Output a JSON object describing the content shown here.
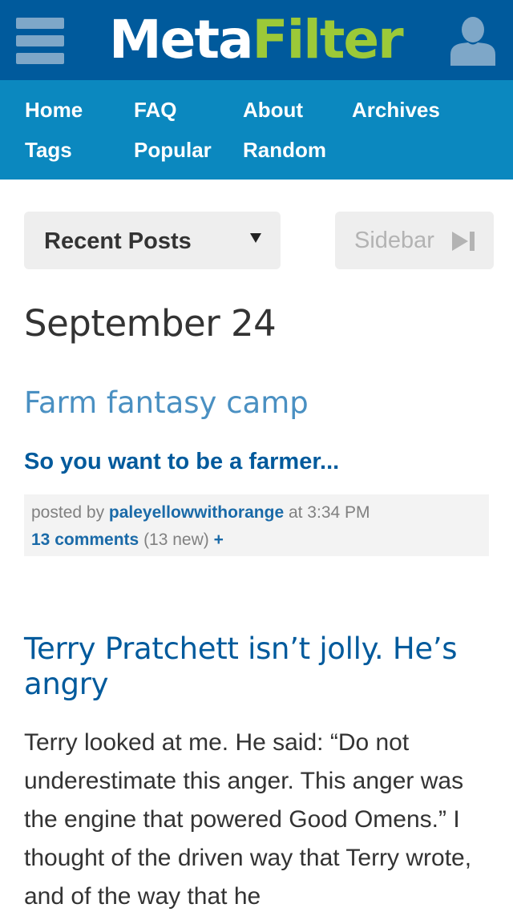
{
  "header": {
    "logo_part1": "Meta",
    "logo_part2": "Filter",
    "menu_icon": "hamburger-menu-icon",
    "user_icon": "user-silhouette-icon"
  },
  "nav": {
    "items": [
      {
        "label": "Home"
      },
      {
        "label": "FAQ"
      },
      {
        "label": "About"
      },
      {
        "label": "Archives"
      },
      {
        "label": "Tags"
      },
      {
        "label": "Popular"
      },
      {
        "label": "Random"
      }
    ]
  },
  "controls": {
    "recent_posts_label": "Recent Posts",
    "sidebar_label": "Sidebar",
    "sidebar_icon": "skip-forward-icon"
  },
  "content": {
    "date_heading": "September 24",
    "posts": [
      {
        "title": "Farm fantasy camp",
        "link_text": "So you want to be a farmer...",
        "meta": {
          "posted_by_prefix": "posted by ",
          "author": "paleyellowwithorange",
          "time_text": " at 3:34 PM",
          "comments_link": "13 comments",
          "comments_new": " (13 new) ",
          "plus": "+"
        }
      },
      {
        "title": "Terry Pratchett isn’t jolly. He’s angry",
        "body": "Terry looked at me. He said: “Do not underestimate this anger. This anger was the engine that powered Good Omens.” I thought of the driven way that Terry wrote, and of the way that he"
      }
    ]
  },
  "colors": {
    "header_bg": "#005a9c",
    "nav_bg": "#0b88bf",
    "logo_accent": "#9cc938",
    "link_blue": "#005a9c",
    "title_blue_light": "#4a90c2"
  }
}
